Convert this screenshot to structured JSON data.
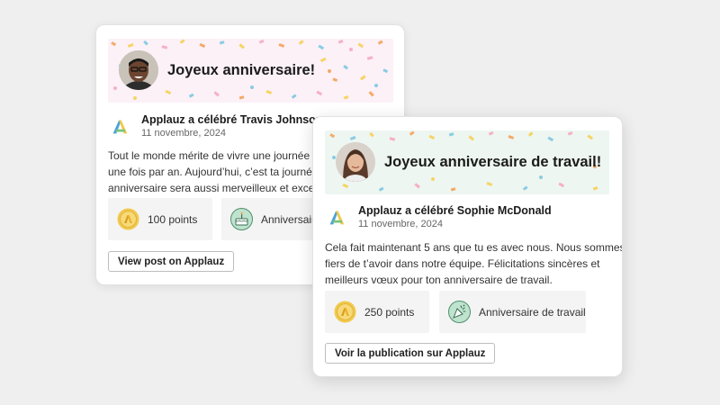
{
  "cards": [
    {
      "banner_title": "Joyeux anniversaire!",
      "author": "Applauz a célébré Travis Johnson",
      "date": "11 novembre, 2024",
      "body_lines": [
        "Tout le monde mérite de vivre une journée spé",
        "une fois par an. Aujourd’hui, c’est ta journée! C",
        "anniversaire sera aussi merveilleux et excepti"
      ],
      "points": "100 points",
      "badge": "Anniversaire",
      "button": "View post on Applauz"
    },
    {
      "banner_title": "Joyeux anniversaire de travail!",
      "author": "Applauz a célébré Sophie McDonald",
      "date": "11 novembre, 2024",
      "body_lines": [
        "Cela fait maintenant 5 ans que tu es avec nous. Nous sommes",
        "fiers de t’avoir dans notre équipe. Félicitations sincères et",
        "meilleurs vœux pour ton anniversaire de travail."
      ],
      "points": "250 points",
      "badge": "Anniversaire de travail",
      "button": "Voir la publication sur Applauz"
    }
  ],
  "icons": {
    "logo": "applauz-logo-icon",
    "points": "coin-icon",
    "badge1": "birthday-cake-icon",
    "badge2": "party-popper-icon"
  },
  "colors": {
    "banner1_bg": "#fbf1f7",
    "banner2_bg": "#eef6f1",
    "coin": "#f2c94c",
    "badge_green": "#7fc4a2"
  }
}
